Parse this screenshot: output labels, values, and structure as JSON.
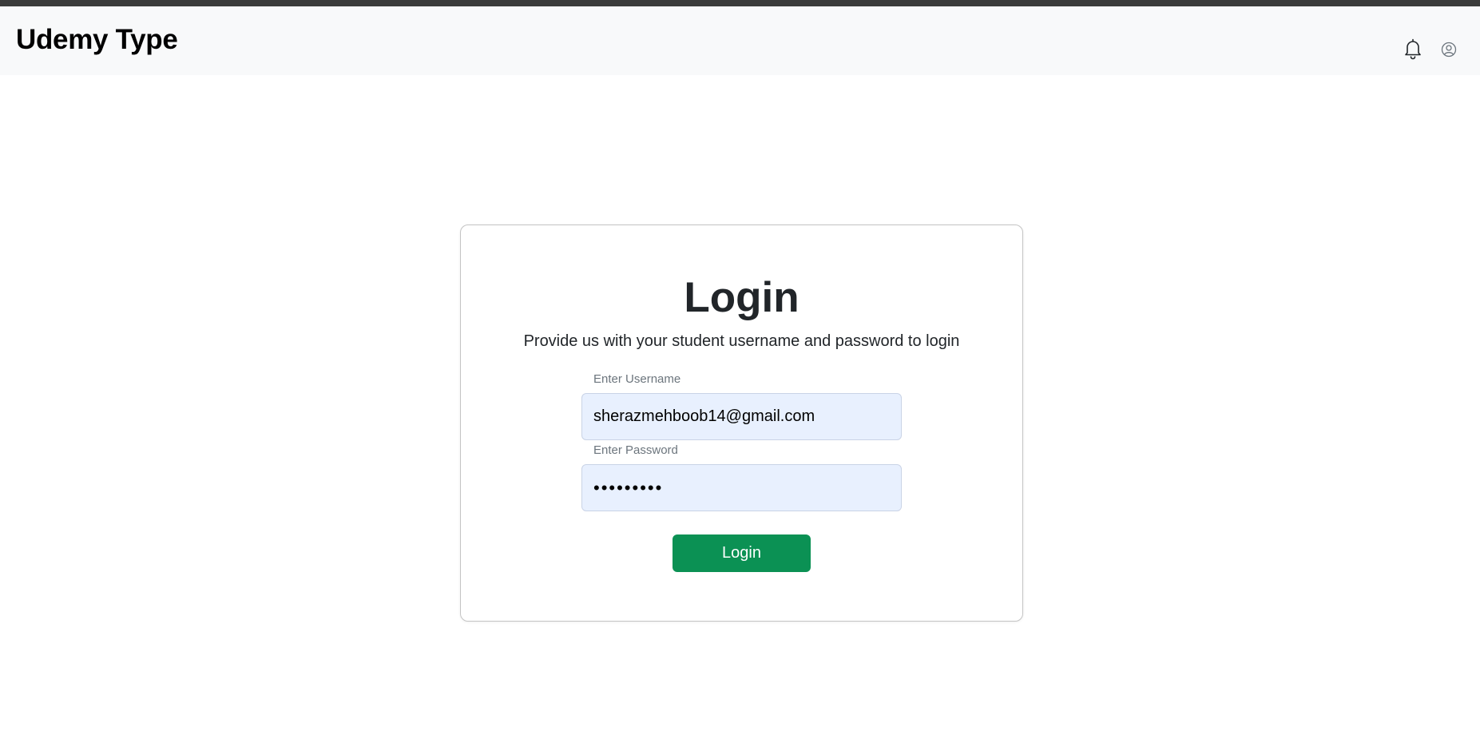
{
  "app": {
    "brand": "Udemy Type"
  },
  "navbar": {
    "icons": [
      "bell-icon",
      "user-circle-icon"
    ]
  },
  "login_card": {
    "title": "Login",
    "subtitle": "Provide us with your student username and password to login",
    "username": {
      "label": "Enter Username",
      "value": "sherazmehboob14@gmail.com"
    },
    "password": {
      "label": "Enter Password",
      "value": "•••••••••"
    },
    "submit_label": "Login"
  },
  "colors": {
    "navbar_bg": "#f8f9fa",
    "top_strip": "#3a3b3a",
    "button": "#0b9154",
    "input_bg": "#e8f0fe"
  }
}
